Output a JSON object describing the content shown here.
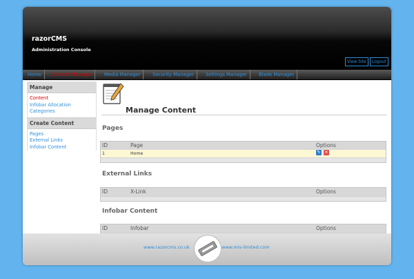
{
  "header": {
    "app_name": "razorCMS",
    "subtitle": "Administration Console",
    "view_site": "View Site",
    "logout": "Logout"
  },
  "nav": {
    "items": [
      {
        "label": "Home"
      },
      {
        "label": "Content Manager"
      },
      {
        "label": "Media Manager"
      },
      {
        "label": "Security Manager"
      },
      {
        "label": "Settings Manager"
      },
      {
        "label": "Blade Manager"
      }
    ],
    "active_index": 1
  },
  "sidebar": {
    "manage_heading": "Manage",
    "manage_items": [
      {
        "label": "Content"
      },
      {
        "label": "Infobar Allocation"
      },
      {
        "label": "Categories"
      }
    ],
    "create_heading": "Create Content",
    "create_items": [
      {
        "label": "Pages"
      },
      {
        "label": "External Links"
      },
      {
        "label": "Infobar Content"
      }
    ]
  },
  "main": {
    "title": "Manage Content",
    "pages": {
      "title": "Pages",
      "headers": {
        "id": "ID",
        "name": "Page",
        "options": "Options"
      },
      "rows": [
        {
          "id": "1",
          "name": "Home"
        }
      ]
    },
    "external_links": {
      "title": "External Links",
      "headers": {
        "id": "ID",
        "name": "X-Link",
        "options": "Options"
      }
    },
    "infobar_content": {
      "title": "Infobar Content",
      "headers": {
        "id": "ID",
        "name": "Infobar",
        "options": "Options"
      }
    }
  },
  "footer": {
    "link_left": "www.razorcms.co.uk",
    "link_right": "www.mis-limited.com"
  },
  "colors": {
    "background": "#62b3ee",
    "link": "#2f8ed8",
    "active": "#d40000",
    "row_highlight": "#fdf8d4"
  },
  "icons": [
    "notepad-pencil-icon",
    "edit-icon",
    "delete-icon",
    "razor-blade-logo"
  ]
}
